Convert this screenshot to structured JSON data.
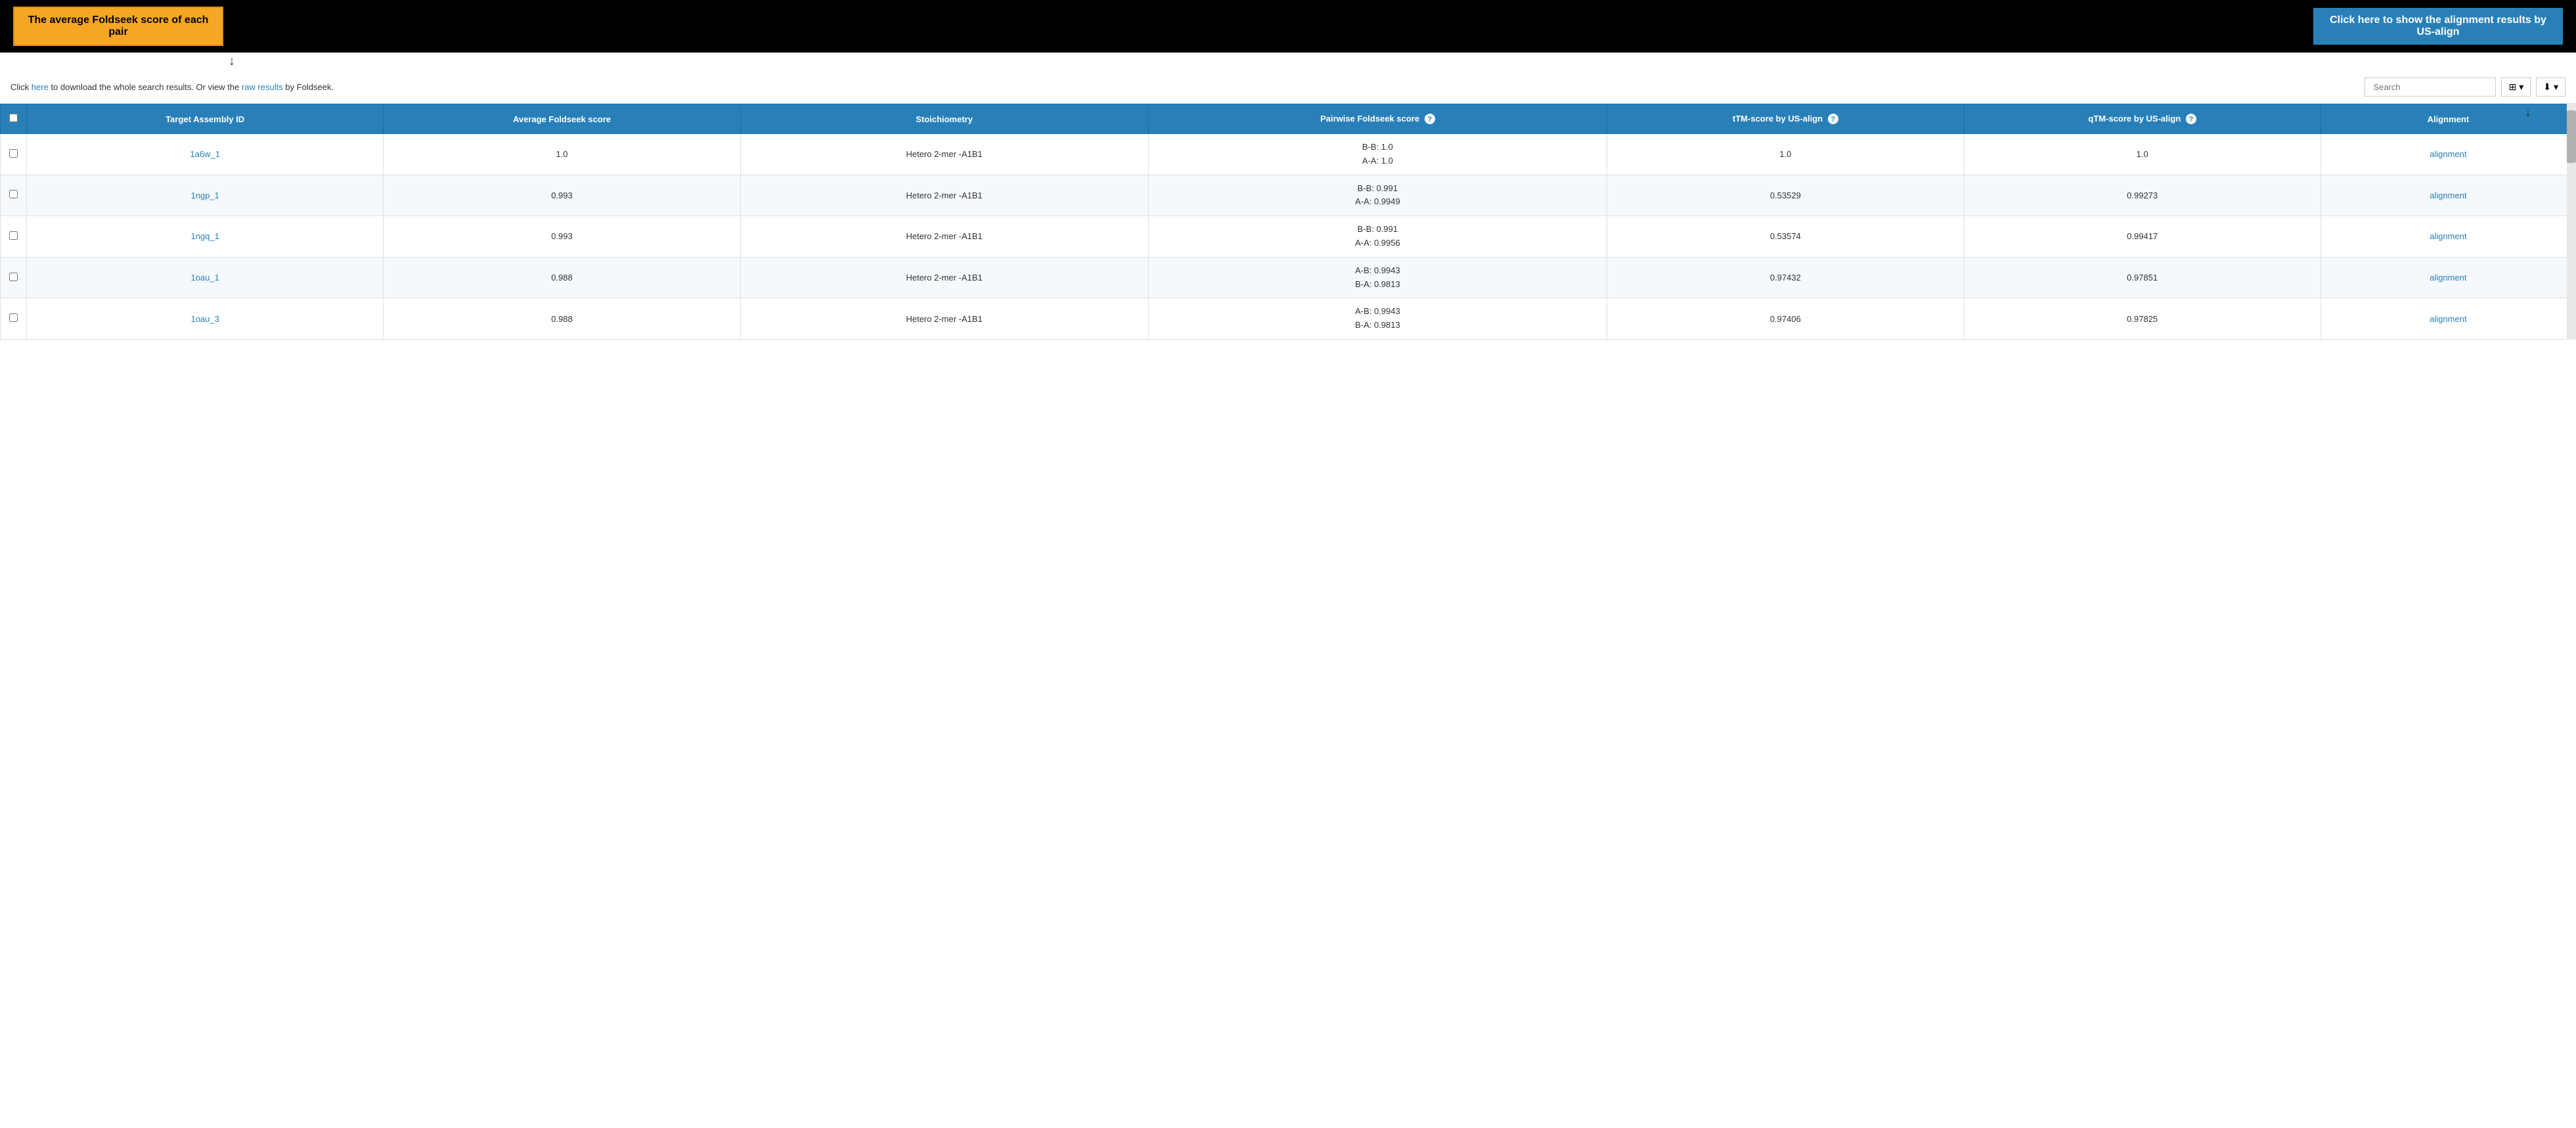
{
  "topbar": {
    "tooltip_yellow": "The average Foldseek score of each pair",
    "tooltip_blue": "Click here to show the alignment results by US-align"
  },
  "toolbar": {
    "info_text": "Click ",
    "here_link": "here",
    "middle_text": " to download the whole search results. Or view the ",
    "raw_link": "raw results",
    "raw_suffix": " by Foldseek.",
    "search_placeholder": "Search",
    "grid_icon": "⊞",
    "download_icon": "⬇"
  },
  "table": {
    "headers": [
      {
        "key": "checkbox",
        "label": ""
      },
      {
        "key": "id",
        "label": "Target Assembly ID"
      },
      {
        "key": "avg",
        "label": "Average Foldseek score"
      },
      {
        "key": "stoich",
        "label": "Stoichiometry"
      },
      {
        "key": "pairwise",
        "label": "Pairwise Foldseek score",
        "help": true
      },
      {
        "key": "ttm",
        "label": "tTM-score by US-align",
        "help": true
      },
      {
        "key": "qtm",
        "label": "qTM-score by US-align",
        "help": true
      },
      {
        "key": "alignment",
        "label": "Alignment"
      }
    ],
    "rows": [
      {
        "id": "1a6w_1",
        "avg": "1.0",
        "stoich": "Hetero 2-mer -A1B1",
        "pairwise_line1": "B-B: 1.0",
        "pairwise_line2": "A-A: 1.0",
        "ttm": "1.0",
        "qtm": "1.0",
        "alignment": "alignment"
      },
      {
        "id": "1ngp_1",
        "avg": "0.993",
        "stoich": "Hetero 2-mer -A1B1",
        "pairwise_line1": "B-B: 0.991",
        "pairwise_line2": "A-A: 0.9949",
        "ttm": "0.53529",
        "qtm": "0.99273",
        "alignment": "alignment"
      },
      {
        "id": "1ngq_1",
        "avg": "0.993",
        "stoich": "Hetero 2-mer -A1B1",
        "pairwise_line1": "B-B: 0.991",
        "pairwise_line2": "A-A: 0.9956",
        "ttm": "0.53574",
        "qtm": "0.99417",
        "alignment": "alignment"
      },
      {
        "id": "1oau_1",
        "avg": "0.988",
        "stoich": "Hetero 2-mer -A1B1",
        "pairwise_line1": "A-B: 0.9943",
        "pairwise_line2": "B-A: 0.9813",
        "ttm": "0.97432",
        "qtm": "0.97851",
        "alignment": "alignment"
      },
      {
        "id": "1oau_3",
        "avg": "0.988",
        "stoich": "Hetero 2-mer -A1B1",
        "pairwise_line1": "A-B: 0.9943",
        "pairwise_line2": "B-A: 0.9813",
        "ttm": "0.97406",
        "qtm": "0.97825",
        "alignment": "alignment"
      }
    ]
  }
}
